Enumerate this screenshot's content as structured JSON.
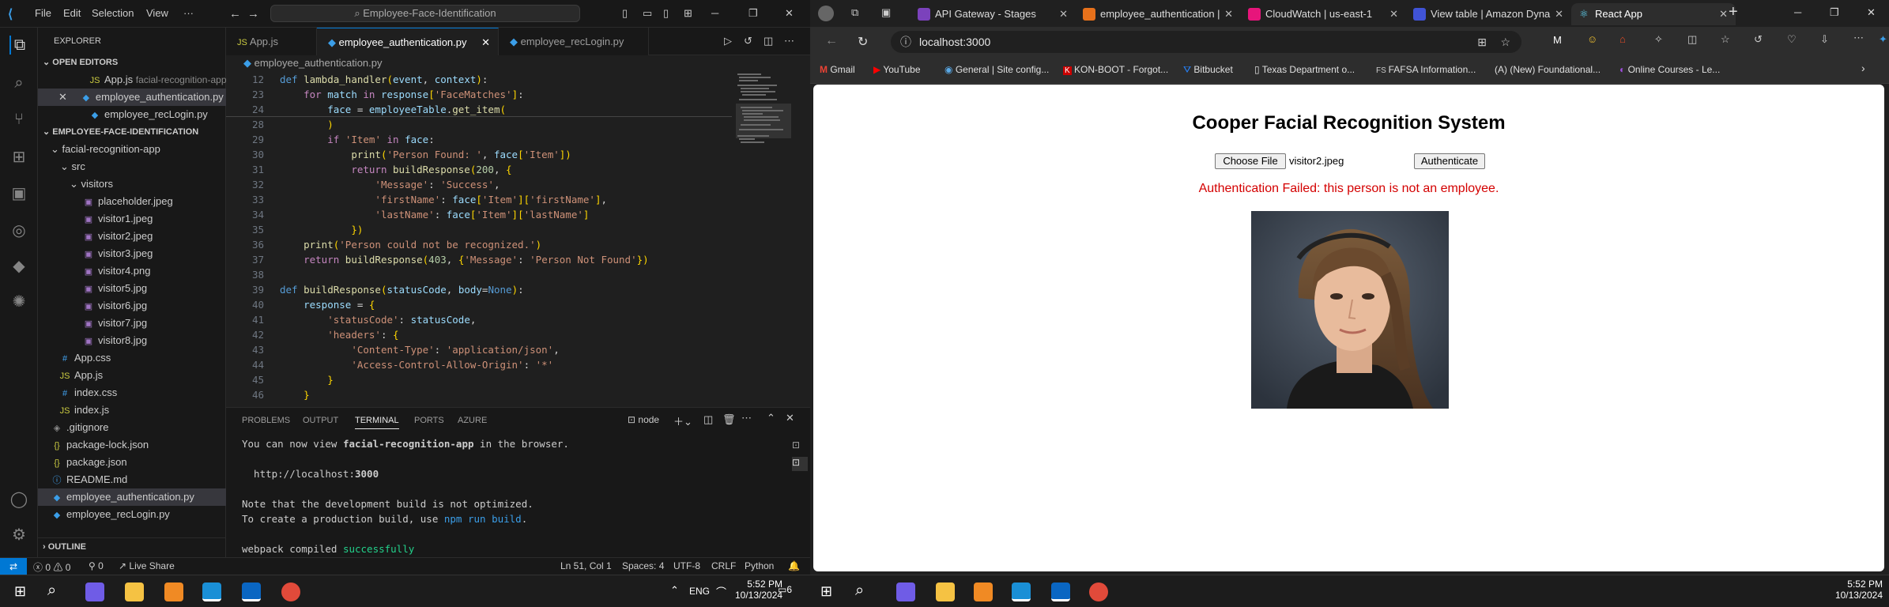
{
  "vscode": {
    "menu": [
      "File",
      "Edit",
      "Selection",
      "View"
    ],
    "more": "···",
    "search": "Employee-Face-Identification",
    "explorer": {
      "title": "EXPLORER",
      "open_editors_label": "OPEN EDITORS",
      "open_editors": [
        {
          "name": "App.js",
          "path": "facial-recognition-app\\..."
        },
        {
          "name": "employee_authentication.py",
          "path": ""
        },
        {
          "name": "employee_recLogin.py",
          "path": ""
        }
      ],
      "project_label": "EMPLOYEE-FACE-IDENTIFICATION",
      "tree": [
        "facial-recognition-app",
        "src",
        "visitors",
        "placeholder.jpeg",
        "visitor1.jpeg",
        "visitor2.jpeg",
        "visitor3.jpeg",
        "visitor4.png",
        "visitor5.jpg",
        "visitor6.jpg",
        "visitor7.jpg",
        "visitor8.jpg",
        "App.css",
        "App.js",
        "index.css",
        "index.js",
        ".gitignore",
        "package-lock.json",
        "package.json",
        "README.md",
        "employee_authentication.py",
        "employee_recLogin.py"
      ],
      "outline_label": "OUTLINE"
    },
    "tabs": [
      "App.js",
      "employee_authentication.py",
      "employee_recLogin.py"
    ],
    "breadcrumb": "employee_authentication.py",
    "code_lines": [
      {
        "n": "12",
        "t": "def lambda_handler(event, context):"
      },
      {
        "n": "23",
        "t": "    for match in response['FaceMatches']:"
      },
      {
        "n": "24",
        "t": "        face = employeeTable.get_item("
      },
      {
        "n": "28",
        "t": "        )"
      },
      {
        "n": "29",
        "t": "        if 'Item' in face:"
      },
      {
        "n": "30",
        "t": "            print('Person Found: ', face['Item'])"
      },
      {
        "n": "31",
        "t": "            return buildResponse(200, {"
      },
      {
        "n": "32",
        "t": "                'Message': 'Success',"
      },
      {
        "n": "33",
        "t": "                'firstName': face['Item']['firstName'],"
      },
      {
        "n": "34",
        "t": "                'lastName': face['Item']['lastName']"
      },
      {
        "n": "35",
        "t": "            })"
      },
      {
        "n": "36",
        "t": "    print('Person could not be recognized.')"
      },
      {
        "n": "37",
        "t": "    return buildResponse(403, {'Message': 'Person Not Found'})"
      },
      {
        "n": "38",
        "t": ""
      },
      {
        "n": "39",
        "t": "def buildResponse(statusCode, body=None):"
      },
      {
        "n": "40",
        "t": "    response = {"
      },
      {
        "n": "41",
        "t": "        'statusCode': statusCode,"
      },
      {
        "n": "42",
        "t": "        'headers': {"
      },
      {
        "n": "43",
        "t": "            'Content-Type': 'application/json',"
      },
      {
        "n": "44",
        "t": "            'Access-Control-Allow-Origin': '*'"
      },
      {
        "n": "45",
        "t": "        }"
      },
      {
        "n": "46",
        "t": "    }"
      }
    ],
    "panel_tabs": [
      "PROBLEMS",
      "OUTPUT",
      "TERMINAL",
      "PORTS",
      "AZURE"
    ],
    "terminal_shell": "node",
    "terminal": {
      "l1a": "You can now view ",
      "l1b": "facial-recognition-app",
      "l1c": " in the browser.",
      "l2a": "  http://localhost:",
      "l2b": "3000",
      "l3": "Note that the development build is not optimized.",
      "l4a": "To create a production build, use ",
      "l4b": "npm run build",
      "l4c": ".",
      "l5a": "webpack compiled ",
      "l5b": "successfully"
    },
    "status": {
      "errors": "0",
      "warnings": "0",
      "ports": "0",
      "live_share": "Live Share",
      "position": "Ln 51, Col 1",
      "spaces": "Spaces: 4",
      "encoding": "UTF-8",
      "eol": "CRLF",
      "language": "Python"
    }
  },
  "browser": {
    "tabs": [
      {
        "label": "API Gateway - Stages",
        "color": "#7b42bc"
      },
      {
        "label": "employee_authentication |",
        "color": "#e7711b"
      },
      {
        "label": "CloudWatch | us-east-1",
        "color": "#e7157b"
      },
      {
        "label": "View table | Amazon Dyna",
        "color": "#4053d6"
      },
      {
        "label": "React App",
        "color": "#61dafb"
      }
    ],
    "url": "localhost:3000",
    "bookmarks": [
      "Gmail",
      "YouTube",
      "General | Site config...",
      "KON-BOOT - Forgot...",
      "Bitbucket",
      "Texas Department o...",
      "FAFSA Information...",
      "(New) Foundational...",
      "Online Courses - Le..."
    ],
    "page": {
      "title": "Cooper Facial Recognition System",
      "choose_file": "Choose File",
      "file_name": "visitor2.jpeg",
      "authenticate": "Authenticate",
      "message": "Authentication Failed: this person is not an employee."
    }
  },
  "taskbar": {
    "lang": "ENG",
    "time_left": "5:52 PM",
    "date_left": "10/13/2024",
    "notif": "6",
    "time_right": "5:52 PM",
    "date_right": "10/13/2024"
  }
}
